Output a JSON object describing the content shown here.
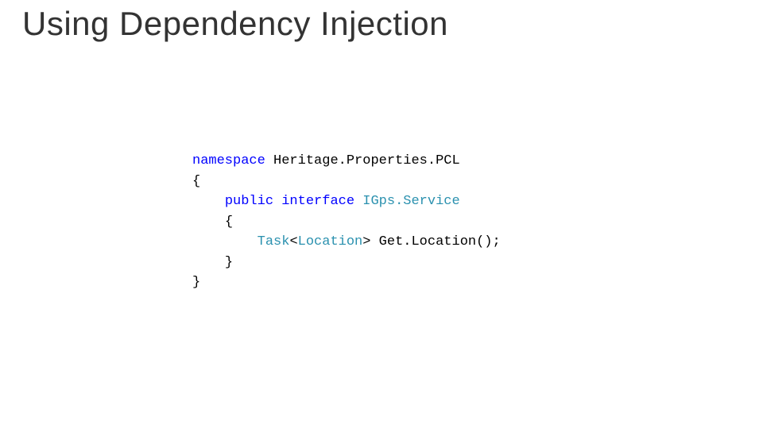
{
  "title": "Using Dependency Injection",
  "code": {
    "t": {
      "namespace": "namespace",
      "public": "public",
      "interface": "interface",
      "ns_name": "Heritage.Properties.PCL",
      "iface_name": "IGps.Service",
      "task": "Task",
      "loc": "Location",
      "method": "Get.Location();",
      "lt": "<",
      "gt": ">",
      "sp": " ",
      "ob": "{",
      "cb": "}",
      "ind1": "    ",
      "ind2": "        "
    }
  }
}
